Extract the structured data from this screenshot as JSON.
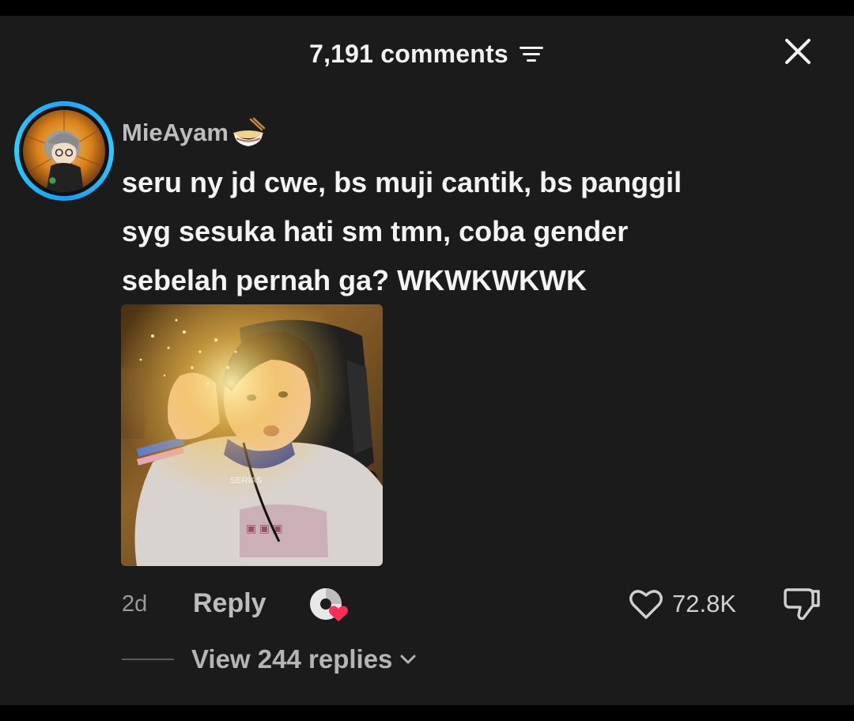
{
  "header": {
    "title": "7,191 comments"
  },
  "comment": {
    "username": "MieAyam",
    "text_lines": [
      "seru ny jd cwe, bs muji cantik, bs panggil",
      "syg sesuka hati sm tmn, coba gender",
      "sebelah pernah ga? WKWKWKWK"
    ],
    "image_watermark": "SERIAS",
    "time": "2d",
    "reply_label": "Reply",
    "like_count": "72.8K",
    "view_replies_label": "View 244 replies"
  },
  "icons": {
    "sort": "sort-lines-icon",
    "close": "close-icon",
    "bowl": "noodle-bowl-emoji-icon",
    "sticker": "sticker-heart-icon",
    "like": "heart-outline-icon",
    "dislike": "thumbs-down-icon",
    "chevron": "chevron-down-icon"
  },
  "colors": {
    "background": "#1b1b1b",
    "avatar_ring": "#1fa7ff",
    "sticker_heart": "#ff2d55"
  }
}
